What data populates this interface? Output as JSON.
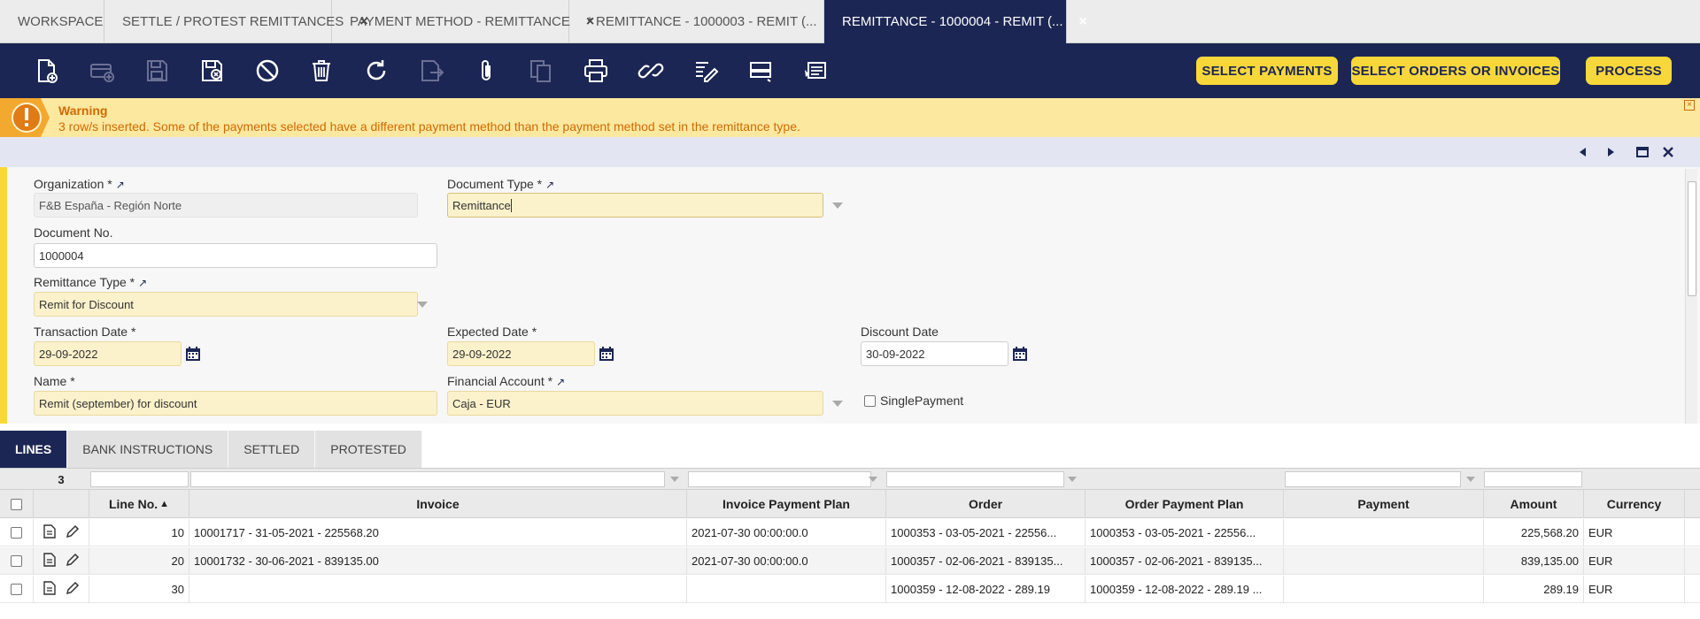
{
  "tabs": [
    {
      "label": "WORKSPACE",
      "closable": false,
      "active": false
    },
    {
      "label": "SETTLE / PROTEST REMITTANCES",
      "closable": true,
      "active": false
    },
    {
      "label": "PAYMENT METHOD - REMITTANCE",
      "closable": true,
      "active": false
    },
    {
      "label": "* REMITTANCE - 1000003 - REMIT (...",
      "closable": true,
      "active": false
    },
    {
      "label": "REMITTANCE - 1000004 - REMIT (...",
      "closable": true,
      "active": true
    }
  ],
  "tab_close_glyph": "×",
  "toolbar": {
    "icons": [
      "new-document-icon",
      "new-row-icon",
      "save-icon",
      "save-close-icon",
      "undo-icon",
      "delete-icon",
      "refresh-icon",
      "export-icon",
      "attachment-icon",
      "copy-record-icon",
      "print-icon",
      "link-icon",
      "audit-trail-icon",
      "toggle-grid-icon",
      "notes-icon"
    ],
    "buttons": {
      "select_payments": "SELECT PAYMENTS",
      "select_orders_invoices": "SELECT ORDERS OR INVOICES",
      "process": "PROCESS"
    }
  },
  "warning": {
    "title": "Warning",
    "message": "3 row/s inserted. Some of the payments selected have a different payment method than the payment method set in the remittance type."
  },
  "form": {
    "organization": {
      "label": "Organization *",
      "value": "F&B España - Región Norte"
    },
    "document_type": {
      "label": "Document Type *",
      "value": "Remittance"
    },
    "document_no": {
      "label": "Document No.",
      "value": "1000004"
    },
    "remittance_type": {
      "label": "Remittance Type *",
      "value": "Remit for Discount"
    },
    "transaction_date": {
      "label": "Transaction Date *",
      "value": "29-09-2022"
    },
    "expected_date": {
      "label": "Expected Date *",
      "value": "29-09-2022"
    },
    "discount_date": {
      "label": "Discount Date",
      "value": "30-09-2022"
    },
    "name": {
      "label": "Name *",
      "value": "Remit (september) for discount"
    },
    "financial_account": {
      "label": "Financial Account *",
      "value": "Caja - EUR"
    },
    "single_payment": {
      "label": "SinglePayment",
      "checked": false
    }
  },
  "subtabs": [
    {
      "label": "LINES",
      "active": true
    },
    {
      "label": "BANK INSTRUCTIONS",
      "active": false
    },
    {
      "label": "SETTLED",
      "active": false
    },
    {
      "label": "PROTESTED",
      "active": false
    }
  ],
  "grid": {
    "record_count": "3",
    "columns": [
      "Line No.",
      "Invoice",
      "Invoice Payment Plan",
      "Order",
      "Order Payment Plan",
      "Payment",
      "Amount",
      "Currency"
    ],
    "sort_indicator": "▲",
    "rows": [
      {
        "line_no": "10",
        "invoice": "10001717 - 31-05-2021 - 225568.20",
        "invoice_payment_plan": "2021-07-30 00:00:00.0",
        "order": "1000353 - 03-05-2021 - 22556...",
        "order_payment_plan": "1000353 - 03-05-2021 - 22556...",
        "payment": "",
        "amount": "225,568.20",
        "currency": "EUR"
      },
      {
        "line_no": "20",
        "invoice": "10001732 - 30-06-2021 - 839135.00",
        "invoice_payment_plan": "2021-07-30 00:00:00.0",
        "order": "1000357 - 02-06-2021 - 839135...",
        "order_payment_plan": "1000357 - 02-06-2021 - 839135...",
        "payment": "",
        "amount": "839,135.00",
        "currency": "EUR"
      },
      {
        "line_no": "30",
        "invoice": "",
        "invoice_payment_plan": "",
        "order": "1000359 - 12-08-2022 - 289.19",
        "order_payment_plan": "1000359 - 12-08-2022 - 289.19 ...",
        "payment": "",
        "amount": "289.19",
        "currency": "EUR"
      }
    ]
  },
  "colors": {
    "navy": "#1c2654",
    "accent_yellow": "#f8d73a",
    "warning_bg": "#fde8a0",
    "warning_text": "#d06a00"
  }
}
